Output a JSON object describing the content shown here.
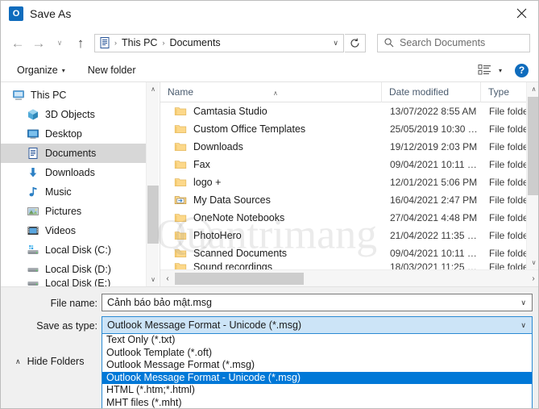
{
  "window": {
    "title": "Save As",
    "app_icon": "outlook-icon",
    "close_label": "✕",
    "accent_color": "#0f6cbd"
  },
  "nav": {
    "back_label": "←",
    "forward_label": "→",
    "recent_label": "∨",
    "up_label": "↑",
    "refresh_label": "↻",
    "address_icon": "documents-folder-icon",
    "breadcrumbs": [
      {
        "label": "This PC"
      },
      {
        "label": "Documents"
      }
    ],
    "separator": "›",
    "dropdown_caret": "∨"
  },
  "search": {
    "icon": "search-icon",
    "placeholder": "Search Documents",
    "value": ""
  },
  "toolbar": {
    "organize_label": "Organize",
    "organize_caret": "▾",
    "new_folder_label": "New folder",
    "view_icon": "list-view-icon",
    "view_caret": "▾",
    "help_label": "?"
  },
  "sidebar": {
    "scroll_up": "∧",
    "scroll_down": "∨",
    "items": [
      {
        "label": "This PC",
        "icon": "this-pc-icon",
        "indent": false,
        "selected": false
      },
      {
        "label": "3D Objects",
        "icon": "3d-objects-icon",
        "indent": true,
        "selected": false
      },
      {
        "label": "Desktop",
        "icon": "desktop-icon",
        "indent": true,
        "selected": false
      },
      {
        "label": "Documents",
        "icon": "documents-icon",
        "indent": true,
        "selected": true
      },
      {
        "label": "Downloads",
        "icon": "downloads-icon",
        "indent": true,
        "selected": false
      },
      {
        "label": "Music",
        "icon": "music-icon",
        "indent": true,
        "selected": false
      },
      {
        "label": "Pictures",
        "icon": "pictures-icon",
        "indent": true,
        "selected": false
      },
      {
        "label": "Videos",
        "icon": "videos-icon",
        "indent": true,
        "selected": false
      },
      {
        "label": "Local Disk (C:)",
        "icon": "local-disk-c-icon",
        "indent": true,
        "selected": false
      },
      {
        "label": "Local Disk (D:)",
        "icon": "local-disk-d-icon",
        "indent": true,
        "selected": false
      },
      {
        "label": "Local Disk (E:)",
        "icon": "local-disk-e-icon",
        "indent": true,
        "selected": false
      }
    ]
  },
  "filepane": {
    "columns": [
      {
        "label": "Name"
      },
      {
        "label": "Date modified"
      },
      {
        "label": "Type"
      }
    ],
    "sort_caret": "∧",
    "scroll_up": "∧",
    "scroll_down": "∨",
    "hscroll_left": "‹",
    "hscroll_right": "›",
    "rows": [
      {
        "name": "Camtasia Studio",
        "date": "13/07/2022 8:55 AM",
        "type": "File folder",
        "icon": "folder-icon"
      },
      {
        "name": "Custom Office Templates",
        "date": "25/05/2019 10:30 …",
        "type": "File folder",
        "icon": "folder-icon"
      },
      {
        "name": "Downloads",
        "date": "19/12/2019 2:03 PM",
        "type": "File folder",
        "icon": "folder-icon"
      },
      {
        "name": "Fax",
        "date": "09/04/2021 10:11 …",
        "type": "File folder",
        "icon": "folder-icon"
      },
      {
        "name": "logo +",
        "date": "12/01/2021 5:06 PM",
        "type": "File folder",
        "icon": "folder-icon"
      },
      {
        "name": "My Data Sources",
        "date": "16/04/2021 2:47 PM",
        "type": "File folder",
        "icon": "special-folder-icon"
      },
      {
        "name": "OneNote Notebooks",
        "date": "27/04/2021 4:48 PM",
        "type": "File folder",
        "icon": "folder-icon"
      },
      {
        "name": "PhotoHero",
        "date": "21/04/2022 11:35 …",
        "type": "File folder",
        "icon": "folder-icon"
      },
      {
        "name": "Scanned Documents",
        "date": "09/04/2021 10:11 …",
        "type": "File folder",
        "icon": "folder-icon"
      },
      {
        "name": "Sound recordings",
        "date": "18/03/2021 11:25 …",
        "type": "File folder",
        "icon": "folder-icon"
      }
    ]
  },
  "bottom": {
    "filename_label": "File name:",
    "filename_value": "Cảnh báo bảo mật.msg",
    "filename_caret": "∨",
    "savetype_label": "Save as type:",
    "savetype_value": "Outlook Message Format - Unicode (*.msg)",
    "savetype_caret": "∨",
    "hide_folders_label": "Hide Folders",
    "hide_folders_chevron": "∧",
    "highlight_color": "#0078d7",
    "combo_fill_color": "#cce4f7"
  },
  "dropdown": {
    "options": [
      {
        "label": "Text Only (*.txt)",
        "selected": false
      },
      {
        "label": "Outlook Template (*.oft)",
        "selected": false
      },
      {
        "label": "Outlook Message Format (*.msg)",
        "selected": false
      },
      {
        "label": "Outlook Message Format - Unicode (*.msg)",
        "selected": true
      },
      {
        "label": "HTML (*.htm;*.html)",
        "selected": false
      },
      {
        "label": "MHT files (*.mht)",
        "selected": false
      }
    ]
  },
  "watermark": {
    "text": "Quantrimang"
  }
}
